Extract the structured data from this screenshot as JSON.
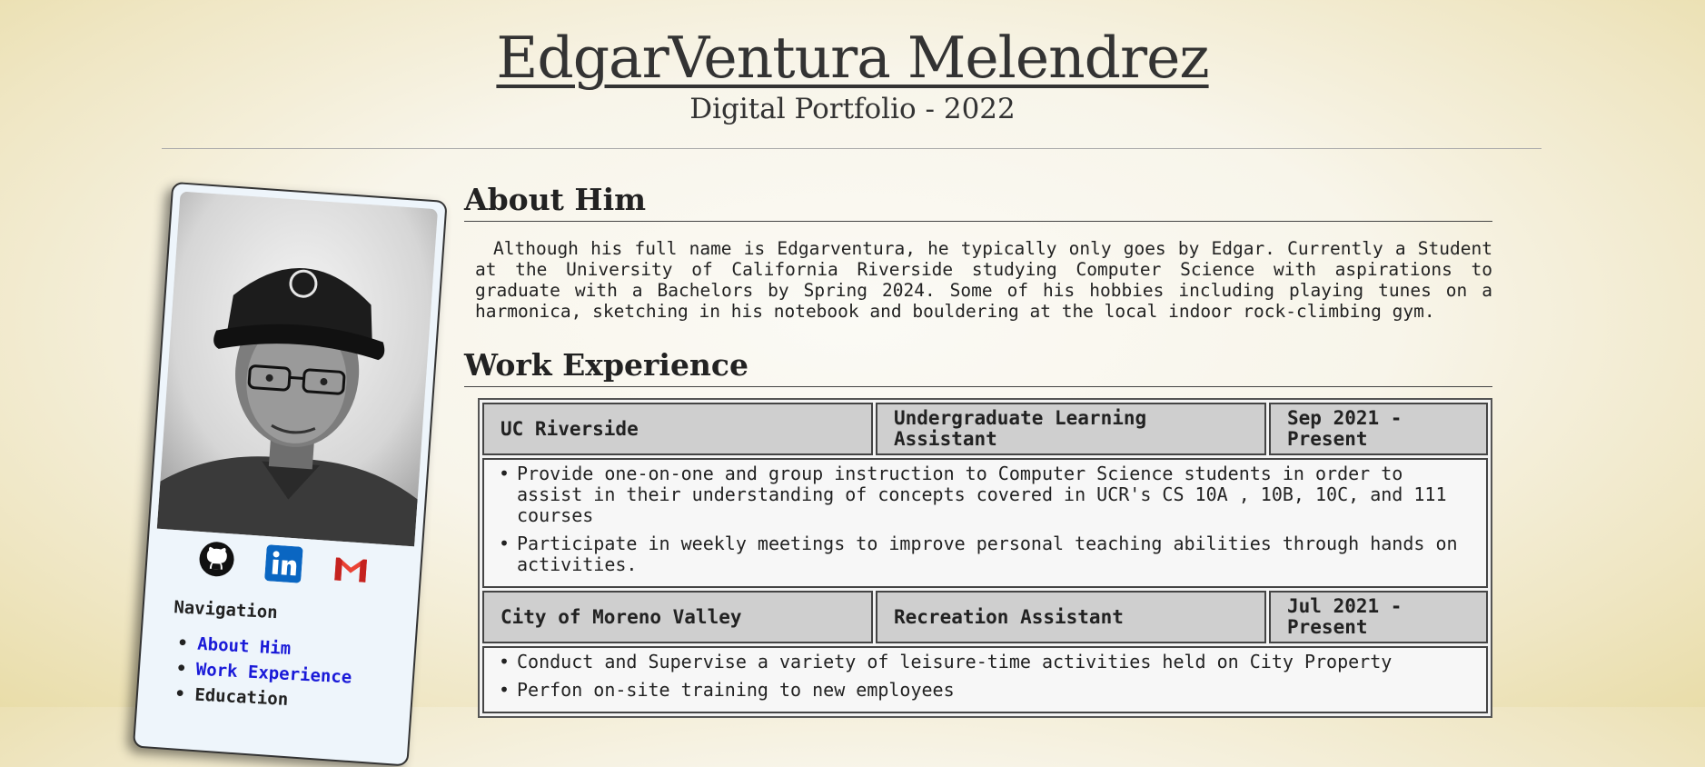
{
  "header": {
    "name": "EdgarVentura Melendrez",
    "subtitle": "Digital Portfolio - 2022"
  },
  "social": {
    "icons": [
      "github-icon",
      "linkedin-icon",
      "gmail-icon"
    ]
  },
  "nav": {
    "title": "Navigation",
    "items": [
      {
        "label": "About Him",
        "link": true
      },
      {
        "label": "Work Experience",
        "link": true
      },
      {
        "label": "Education",
        "link": false
      }
    ]
  },
  "about": {
    "title": "About Him",
    "text": "Although his full name is Edgarventura, he typically only goes by Edgar. Currently a Student at the University of California Riverside studying Computer Science with aspirations to graduate with a Bachelors by Spring 2024. Some of his hobbies including playing tunes on a harmonica, sketching in his notebook and bouldering at the local indoor rock-climbing gym."
  },
  "work": {
    "title": "Work Experience",
    "jobs": [
      {
        "org": "UC Riverside",
        "role": "Undergraduate Learning Assistant",
        "dates": "Sep 2021 - Present",
        "bullets": [
          "Provide one-on-one and group instruction to Computer Science students in order to assist in their understanding of concepts covered in UCR's CS 10A , 10B, 10C, and 111 courses",
          "Participate in weekly meetings to improve personal teaching abilities through hands on activities."
        ]
      },
      {
        "org": "City of Moreno Valley",
        "role": "Recreation Assistant",
        "dates": "Jul 2021 - Present",
        "bullets": [
          "Conduct and Supervise a variety of leisure-time activities held on City Property",
          "Perfon on-site training to new employees"
        ]
      }
    ]
  },
  "colors": {
    "link": "#1a1ad8",
    "table_header": "#cfcfcf",
    "card_bg": "#eef5fb",
    "linkedin": "#0a66c2",
    "gmail": "#ea4335"
  }
}
